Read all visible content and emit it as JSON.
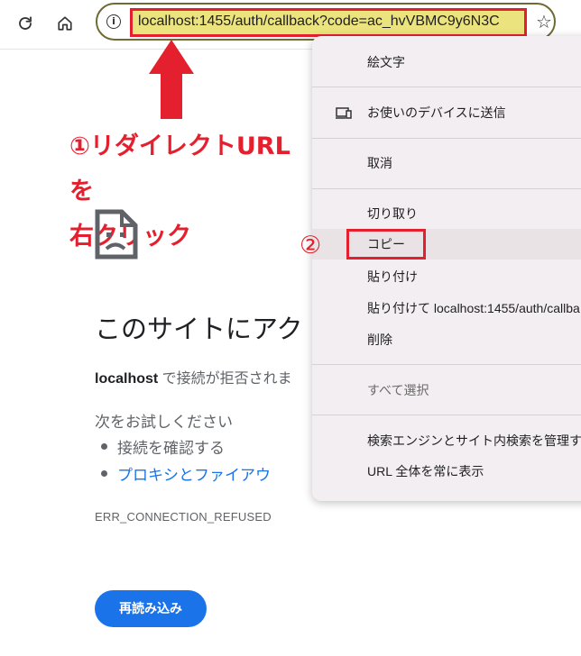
{
  "toolbar": {
    "url": "localhost:1455/auth/callback?code=ac_hvVBMC9y6N3C",
    "info_icon": "i",
    "star_icon": "☆"
  },
  "annotations": {
    "step1_line1": "①リダイレクトURLを",
    "step1_line2": "右クリック",
    "step2": "②",
    "accent_color": "#e5202e"
  },
  "error_page": {
    "heading": "このサイトにアク",
    "host": "localhost",
    "desc": " で接続が拒否されま",
    "try_heading": "次をお試しください",
    "suggestions": [
      "接続を確認する",
      "プロキシとファイアウ"
    ],
    "error_code": "ERR_CONNECTION_REFUSED",
    "reload_label": "再読み込み"
  },
  "context_menu": {
    "items": [
      {
        "label": "絵文字"
      },
      {
        "label": "お使いのデバイスに送信",
        "icon": "device-send-icon"
      },
      {
        "label": "取消"
      },
      {
        "label": "切り取り"
      },
      {
        "label": "コピー"
      },
      {
        "label": "貼り付け"
      },
      {
        "label": "貼り付けて localhost:1455/auth/callba"
      },
      {
        "label": "削除"
      },
      {
        "label": "すべて選択"
      },
      {
        "label": "検索エンジンとサイト内検索を管理する"
      },
      {
        "label": "URL 全体を常に表示"
      }
    ]
  }
}
